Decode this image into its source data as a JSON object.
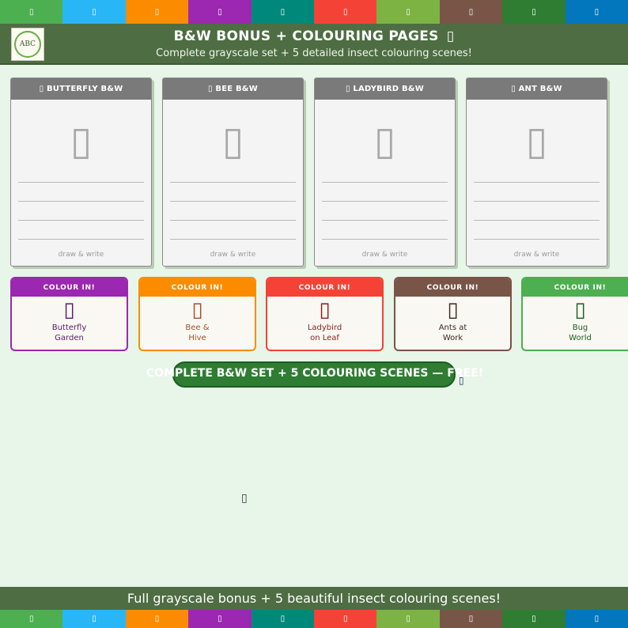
{
  "stripe_top": [
    {
      "color": "#4caf50",
      "icon": "▯"
    },
    {
      "color": "#29b6f6",
      "icon": "▯"
    },
    {
      "color": "#fb8c00",
      "icon": "▯"
    },
    {
      "color": "#9c27b0",
      "icon": "▯"
    },
    {
      "color": "#00897b",
      "icon": "▯"
    },
    {
      "color": "#f44336",
      "icon": "▯"
    },
    {
      "color": "#7cb342",
      "icon": "▯"
    },
    {
      "color": "#795548",
      "icon": "▯"
    },
    {
      "color": "#2e7d32",
      "icon": "▯"
    },
    {
      "color": "#0277bd",
      "icon": "▯"
    }
  ],
  "stripe_bottom": [
    {
      "color": "#4caf50",
      "icon": "▯"
    },
    {
      "color": "#29b6f6",
      "icon": "▯"
    },
    {
      "color": "#fb8c00",
      "icon": "▯"
    },
    {
      "color": "#9c27b0",
      "icon": "▯"
    },
    {
      "color": "#00897b",
      "icon": "▯"
    },
    {
      "color": "#f44336",
      "icon": "▯"
    },
    {
      "color": "#7cb342",
      "icon": "▯"
    },
    {
      "color": "#795548",
      "icon": "▯"
    },
    {
      "color": "#2e7d32",
      "icon": "▯"
    },
    {
      "color": "#0277bd",
      "icon": "▯"
    }
  ],
  "banner": {
    "logo_text": "ABC",
    "title": "B&W BONUS + COLOURING PAGES",
    "title_icon": "▯",
    "subtitle": "Complete grayscale set + 5 detailed insect colouring scenes!"
  },
  "bw_cards": [
    {
      "title": "▯ BUTTERFLY B&W",
      "icon": "▯",
      "footer": "draw & write"
    },
    {
      "title": "▯ BEE B&W",
      "icon": "▯",
      "footer": "draw & write"
    },
    {
      "title": "▯ LADYBIRD B&W",
      "icon": "▯",
      "footer": "draw & write"
    },
    {
      "title": "▯ ANT B&W",
      "icon": "▯",
      "footer": "draw & write"
    }
  ],
  "colour_cards": [
    {
      "header": "COLOUR IN!",
      "icon": "▯",
      "line1": "Butterfly",
      "line2": "Garden",
      "color": "#9c27b0",
      "text_color": "#5b1a6e"
    },
    {
      "header": "COLOUR IN!",
      "icon": "▯",
      "line1": "Bee &",
      "line2": "Hive",
      "color": "#fb8c00",
      "text_color": "#a0522d"
    },
    {
      "header": "COLOUR IN!",
      "icon": "▯",
      "line1": "Ladybird",
      "line2": "on Leaf",
      "color": "#f44336",
      "text_color": "#8e1c1c"
    },
    {
      "header": "COLOUR IN!",
      "icon": "▯",
      "line1": "Ants at",
      "line2": "Work",
      "color": "#795548",
      "text_color": "#3e2723"
    },
    {
      "header": "COLOUR IN!",
      "icon": "▯",
      "line1": "Bug",
      "line2": "World",
      "color": "#4caf50",
      "text_color": "#1b5e20"
    }
  ],
  "cta": {
    "label": "COMPLETE B&W SET + 5 COLOURING SCENES — FREE!"
  },
  "cursor_icon": "▯",
  "stray_icon": "▯",
  "footer": {
    "text": "Full grayscale bonus + 5 beautiful insect colouring scenes!"
  }
}
